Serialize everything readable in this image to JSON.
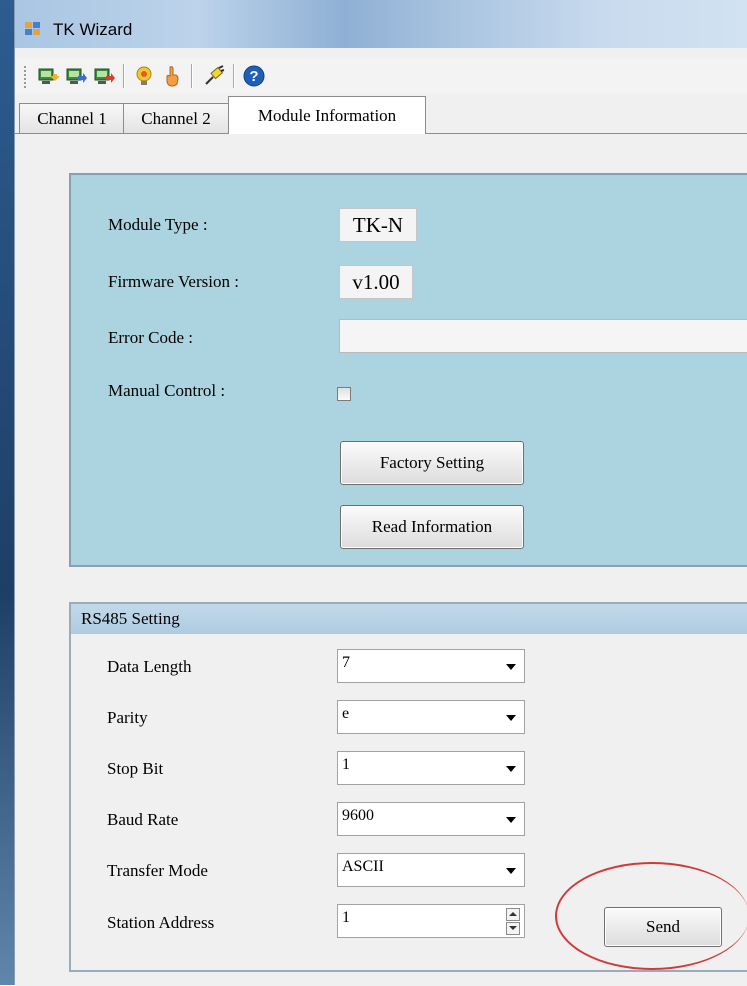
{
  "window": {
    "title": "TK Wizard"
  },
  "toolbar": {
    "buttons": [
      {
        "icon": "upload-icon"
      },
      {
        "icon": "download-icon"
      },
      {
        "icon": "download-red-icon"
      },
      {
        "icon": "bulb-icon"
      },
      {
        "icon": "hand-icon"
      },
      {
        "icon": "connect-icon"
      },
      {
        "icon": "help-icon"
      }
    ]
  },
  "tabs": [
    "Channel 1",
    "Channel 2",
    "Module Information"
  ],
  "active_tab": "Module Information",
  "module_info": {
    "module_type_label": "Module Type :",
    "module_type_value": "TK-N",
    "firmware_label": "Firmware Version :",
    "firmware_value": "v1.00",
    "error_label": "Error Code :",
    "error_value": "",
    "manual_label": "Manual Control :",
    "manual_checked": false,
    "factory_button": "Factory Setting",
    "read_button": "Read Information"
  },
  "rs485": {
    "title": "RS485 Setting",
    "fields": [
      {
        "label": "Data Length",
        "value": "7"
      },
      {
        "label": "Parity",
        "value": "e"
      },
      {
        "label": "Stop Bit",
        "value": "1"
      },
      {
        "label": "Baud Rate",
        "value": "9600"
      },
      {
        "label": "Transfer Mode",
        "value": "ASCII"
      },
      {
        "label": "Station Address",
        "value": "1"
      }
    ],
    "send_button": "Send"
  },
  "colors": {
    "info_panel_bg": "#abd4e0",
    "highlight_circle": "#d13a3a"
  }
}
